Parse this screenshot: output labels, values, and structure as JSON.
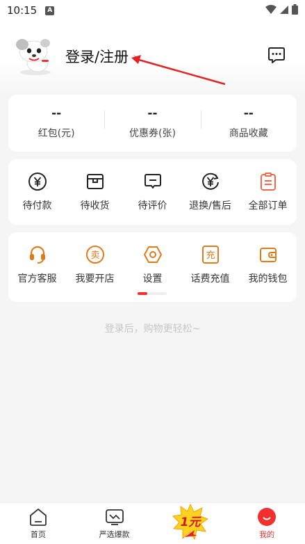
{
  "status_bar": {
    "time": "10:15",
    "notification_letter": "A",
    "icons": [
      "wifi-icon",
      "signal-icon",
      "battery-icon"
    ]
  },
  "profile": {
    "login_label": "登录/注册",
    "chevron": "›",
    "message_icon": "message-icon"
  },
  "stats": [
    {
      "value": "--",
      "label": "红包(元)"
    },
    {
      "value": "--",
      "label": "优惠券(张)"
    },
    {
      "value": "--",
      "label": "商品收藏"
    }
  ],
  "orders": [
    {
      "label": "待付款",
      "icon": "yuan-circle-icon"
    },
    {
      "label": "待收货",
      "icon": "package-icon"
    },
    {
      "label": "待评价",
      "icon": "comment-icon"
    },
    {
      "label": "退换/售后",
      "icon": "refund-icon"
    },
    {
      "label": "全部订单",
      "icon": "clipboard-icon"
    }
  ],
  "tools": [
    {
      "label": "官方客服",
      "icon": "headset-icon"
    },
    {
      "label": "我要开店",
      "icon": "sell-icon",
      "glyph": "卖"
    },
    {
      "label": "设置",
      "icon": "settings-hexagon-icon"
    },
    {
      "label": "话费充值",
      "icon": "recharge-icon",
      "glyph": "充"
    },
    {
      "label": "我的钱包",
      "icon": "wallet-icon"
    }
  ],
  "hint": "登录后，购物更轻松~",
  "tabbar": [
    {
      "label": "首页",
      "icon": "home-icon",
      "active": false
    },
    {
      "label": "严选爆款",
      "icon": "tv-trend-icon",
      "active": false
    },
    {
      "label": "",
      "icon": "one-yuan-promo-icon",
      "active": false
    },
    {
      "label": "我的",
      "icon": "profile-smile-icon",
      "active": true
    }
  ],
  "promo_text": "1元",
  "colors": {
    "accent": "#f23030",
    "tool_orange": "#e07b1a",
    "order_red": "#f06a4a",
    "background": "#f5f5f5"
  }
}
